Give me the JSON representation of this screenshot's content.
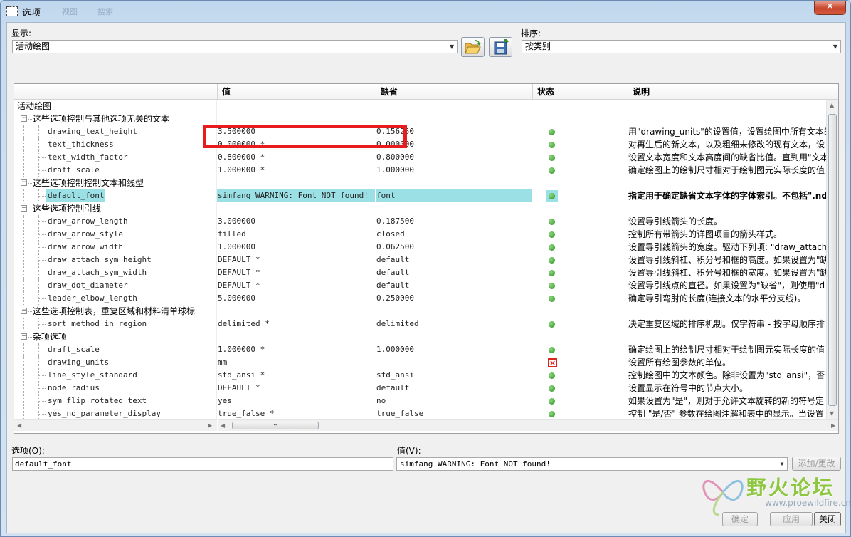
{
  "window": {
    "title": "选项",
    "ghost_menu": [
      "视图",
      "搜索"
    ],
    "close_label": "✕"
  },
  "top": {
    "display_label": "显示:",
    "display_value": "活动绘图",
    "sort_label": "排序:",
    "sort_value": "按类别"
  },
  "grid": {
    "headers": {
      "name": "",
      "value": "值",
      "default": "缺省",
      "status": "状态",
      "desc": "说明"
    },
    "rows": [
      {
        "type": "root",
        "label": "活动绘图"
      },
      {
        "type": "group",
        "label": "这些选项控制与其他选项无关的文本"
      },
      {
        "type": "item",
        "name": "drawing_text_height",
        "value": "3.500000",
        "default": "0.156250",
        "status": "ok",
        "desc": "用\"drawing_units\"的设置值，设置绘图中所有文本的"
      },
      {
        "type": "item",
        "name": "text_thickness",
        "value": "0.000000 *",
        "default": "0.000000",
        "status": "ok",
        "desc": "对再生后的新文本，以及粗细未修改的现有文本，设"
      },
      {
        "type": "item",
        "name": "text_width_factor",
        "value": "0.800000 *",
        "default": "0.800000",
        "status": "ok",
        "desc": "设置文本宽度和文本高度间的缺省比值。直到用\"文本"
      },
      {
        "type": "item",
        "name": "draft_scale",
        "value": "1.000000 *",
        "default": "1.000000",
        "status": "ok",
        "desc": "确定绘图上的绘制尺寸相对于绘制图元实际长度的值"
      },
      {
        "type": "group",
        "label": "这些选项控制控制文本和线型"
      },
      {
        "type": "item",
        "selected": true,
        "name": "default_font",
        "value": "simfang      WARNING: Font NOT found!",
        "default": "font",
        "status": "ok",
        "desc": "指定用于确定缺省文本字体的字体索引。不包括\".nd"
      },
      {
        "type": "group",
        "label": "这些选项控制引线"
      },
      {
        "type": "item",
        "name": "draw_arrow_length",
        "value": "3.000000",
        "default": "0.187500",
        "status": "ok",
        "desc": "设置导引线箭头的长度。"
      },
      {
        "type": "item",
        "name": "draw_arrow_style",
        "value": "filled",
        "default": "closed",
        "status": "ok",
        "desc": "控制所有带箭头的详图项目的箭头样式。"
      },
      {
        "type": "item",
        "name": "draw_arrow_width",
        "value": "1.000000",
        "default": "0.062500",
        "status": "ok",
        "desc": "设置导引线箭头的宽度。驱动下列项: \"draw_attach"
      },
      {
        "type": "item",
        "name": "draw_attach_sym_height",
        "value": "DEFAULT *",
        "default": "default",
        "status": "ok",
        "desc": "设置导引线斜杠、积分号和框的高度。如果设置为\"缺"
      },
      {
        "type": "item",
        "name": "draw_attach_sym_width",
        "value": "DEFAULT *",
        "default": "default",
        "status": "ok",
        "desc": "设置导引线斜杠、积分号和框的宽度。如果设置为\"缺"
      },
      {
        "type": "item",
        "name": "draw_dot_diameter",
        "value": "DEFAULT *",
        "default": "default",
        "status": "ok",
        "desc": "设置导引线点的直径。如果设置为\"缺省\"，则使用\"d"
      },
      {
        "type": "item",
        "name": "leader_elbow_length",
        "value": "5.000000",
        "default": "0.250000",
        "status": "ok",
        "desc": "确定导引弯肘的长度(连接文本的水平分支线)。"
      },
      {
        "type": "group",
        "label": "这些选项控制表，重复区域和材料清单球标"
      },
      {
        "type": "item",
        "name": "sort_method_in_region",
        "value": "delimited *",
        "default": "delimited",
        "status": "ok",
        "desc": "决定重复区域的排序机制。仅字符串 - 按字母顺序排"
      },
      {
        "type": "group",
        "label": "杂项选项"
      },
      {
        "type": "item",
        "name": "draft_scale",
        "value": "1.000000 *",
        "default": "1.000000",
        "status": "ok",
        "desc": "确定绘图上的绘制尺寸相对于绘制图元实际长度的值"
      },
      {
        "type": "item",
        "name": "drawing_units",
        "value": "mm",
        "default": "",
        "status": "error",
        "desc": "设置所有绘图参数的单位。"
      },
      {
        "type": "item",
        "name": "line_style_standard",
        "value": "std_ansi *",
        "default": "std_ansi",
        "status": "ok",
        "desc": "控制绘图中的文本颜色。除非设置为\"std_ansi\"，否"
      },
      {
        "type": "item",
        "name": "node_radius",
        "value": "DEFAULT *",
        "default": "default",
        "status": "ok",
        "desc": "设置显示在符号中的节点大小。"
      },
      {
        "type": "item",
        "name": "sym_flip_rotated_text",
        "value": "yes",
        "default": "no",
        "status": "ok",
        "desc": "如果设置为\"是\"，则对于允许文本旋转的新的符号定"
      },
      {
        "type": "item",
        "name": "yes_no_parameter_display",
        "value": "true_false *",
        "default": "true_false",
        "status": "ok",
        "desc": "控制 \"是/否\" 参数在绘图注解和表中的显示。当设置"
      }
    ]
  },
  "bottom": {
    "option_label": "选项(O):",
    "option_value": "default_font",
    "value_label": "值(V):",
    "value_value": "simfang      WARNING: Font NOT found!",
    "add_change_label": "添加/更改",
    "ok_label": "确定",
    "apply_label": "应用",
    "close_label": "关闭"
  },
  "watermark": {
    "text": "野火论坛",
    "url": "www.proewildfire.cn"
  },
  "colors": {
    "selected_row": "#9be0e5",
    "highlight_box": "#e81c1c",
    "status_ok": "#2b8a22",
    "status_error": "#d9261c"
  }
}
